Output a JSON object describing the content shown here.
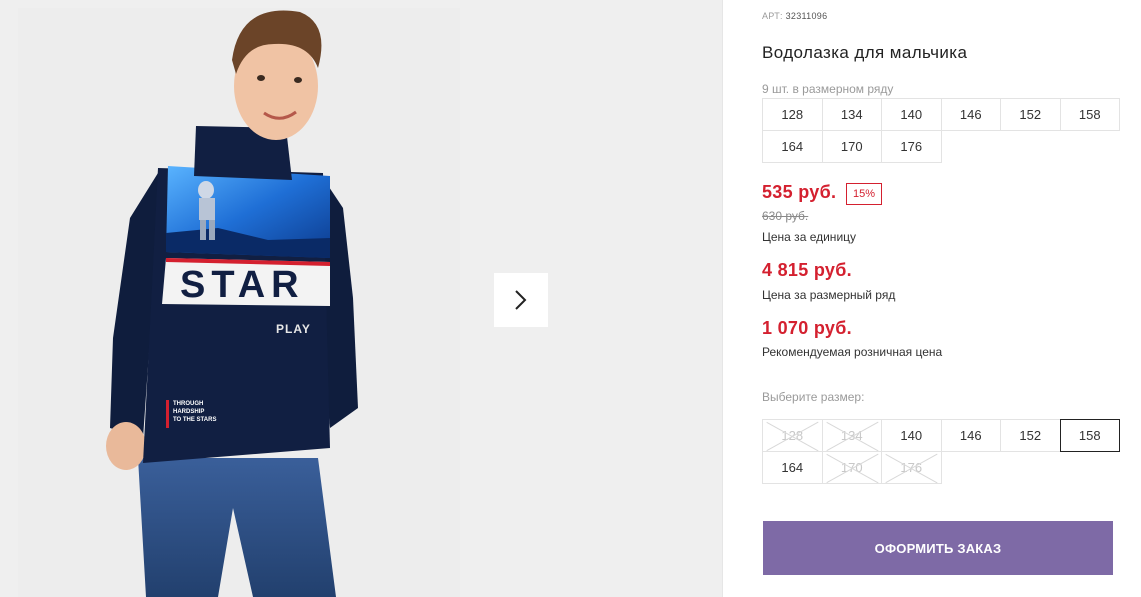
{
  "product": {
    "article_label": "АРТ:",
    "article_value": "32311096",
    "title": "Водолазка для мальчика",
    "size_row_count": "9 шт. в размерном ряду",
    "size_row": [
      "128",
      "134",
      "140",
      "146",
      "152",
      "158",
      "164",
      "170",
      "176"
    ],
    "image_print": {
      "main_word": "STAR",
      "sub_word": "PLAY",
      "slogan_1": "THROUGH",
      "slogan_2": "HARDSHIP",
      "slogan_3": "TO THE STARS"
    }
  },
  "prices": {
    "unit_price": "535 руб.",
    "discount_badge": "15%",
    "old_price": "630 руб.",
    "unit_label": "Цена за единицу",
    "row_price": "4 815 руб.",
    "row_label": "Цена за размерный ряд",
    "retail_price": "1 070 руб.",
    "retail_label": "Рекомендуемая розничная цена"
  },
  "size_picker": {
    "label": "Выберите размер:",
    "options": [
      {
        "size": "128",
        "state": "unavailable"
      },
      {
        "size": "134",
        "state": "unavailable"
      },
      {
        "size": "140",
        "state": "available"
      },
      {
        "size": "146",
        "state": "available"
      },
      {
        "size": "152",
        "state": "available"
      },
      {
        "size": "158",
        "state": "selected"
      },
      {
        "size": "164",
        "state": "available"
      },
      {
        "size": "170",
        "state": "unavailable"
      },
      {
        "size": "176",
        "state": "unavailable"
      }
    ]
  },
  "order_button": "ОФОРМИТЬ ЗАКАЗ",
  "colors": {
    "price_red": "#d4202f",
    "order_button": "#7e6aa6"
  }
}
